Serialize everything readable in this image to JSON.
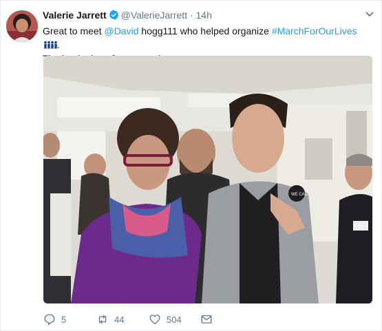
{
  "tweet": {
    "name": "Valerie Jarrett",
    "handle": "@ValerieJarrett",
    "separator": "·",
    "time": "14h",
    "text_pre": "Great to meet ",
    "mention": "@David",
    "text_mid": " hogg111 who helped organize ",
    "hashtag": "#MarchForOurLives",
    "text_post": ".",
    "line2": "The beginning of our marathon..",
    "badge_text": "WE CALL"
  },
  "actions": {
    "replies": "5",
    "retweets": "44",
    "likes": "504"
  },
  "colors": {
    "link": "#1da1f2",
    "muted": "#657786",
    "verified": "#1da1f2"
  },
  "icons": [
    "verified-badge-icon",
    "chevron-down-icon",
    "people-emoji-icon",
    "reply-icon",
    "retweet-icon",
    "like-icon",
    "message-icon"
  ]
}
